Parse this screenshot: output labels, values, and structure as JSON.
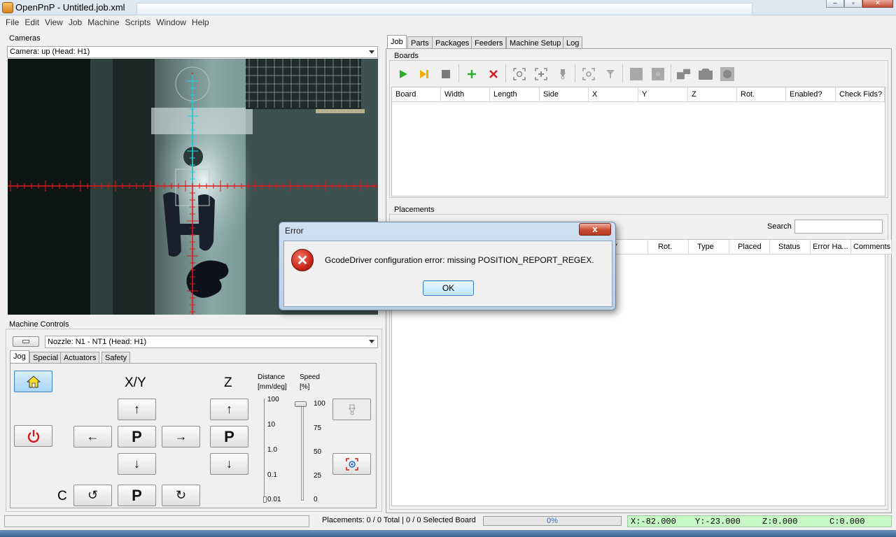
{
  "window": {
    "title": "OpenPnP - Untitled.job.xml"
  },
  "menu": [
    "File",
    "Edit",
    "View",
    "Job",
    "Machine",
    "Scripts",
    "Window",
    "Help"
  ],
  "cameras": {
    "label": "Cameras",
    "selected": "Camera: up (Head: H1)"
  },
  "machine_controls": {
    "label": "Machine Controls",
    "nozzle_selected": "Nozzle: N1 - NT1 (Head: H1)",
    "tabs": [
      "Jog",
      "Special",
      "Actuators",
      "Safety"
    ],
    "xy_label": "X/Y",
    "z_label": "Z",
    "c_label": "C",
    "park_label": "P",
    "distance_label": "Distance",
    "distance_unit": "[mm/deg]",
    "speed_label": "Speed",
    "speed_unit": "[%]",
    "distance_ticks": [
      "100",
      "10",
      "1.0",
      "0.1",
      "0.01"
    ],
    "speed_ticks": [
      "100",
      "75",
      "50",
      "25",
      "0"
    ],
    "distance_value": "0.01",
    "speed_value_percent": 100
  },
  "tabs_right": [
    "Job",
    "Parts",
    "Packages",
    "Feeders",
    "Machine Setup",
    "Log"
  ],
  "boards": {
    "label": "Boards",
    "columns": [
      "Board",
      "Width",
      "Length",
      "Side",
      "X",
      "Y",
      "Z",
      "Rot.",
      "Enabled?",
      "Check Fids?"
    ]
  },
  "placements": {
    "label": "Placements",
    "search_label": "Search",
    "search_value": "",
    "columns": [
      "Y",
      "Rot.",
      "Type",
      "Placed",
      "Status",
      "Error Ha...",
      "Comments"
    ]
  },
  "status": {
    "placements_text": "Placements: 0 / 0 Total | 0 / 0 Selected Board",
    "progress": "0%",
    "dro_x": "X:-82.000",
    "dro_y": "Y:-23.000",
    "dro_z": "Z:0.000",
    "dro_c": "C:0.000"
  },
  "dialog": {
    "title": "Error",
    "message": "GcodeDriver configuration error: missing POSITION_REPORT_REGEX.",
    "ok_label": "OK",
    "close_label": "x"
  },
  "colors": {
    "dro_bg": "#c6f8c6",
    "crosshair": "#e01818",
    "crosshair_vertical": "#18d8e8",
    "start_green": "#2bb02b",
    "stop_red": "#d81b1b"
  }
}
